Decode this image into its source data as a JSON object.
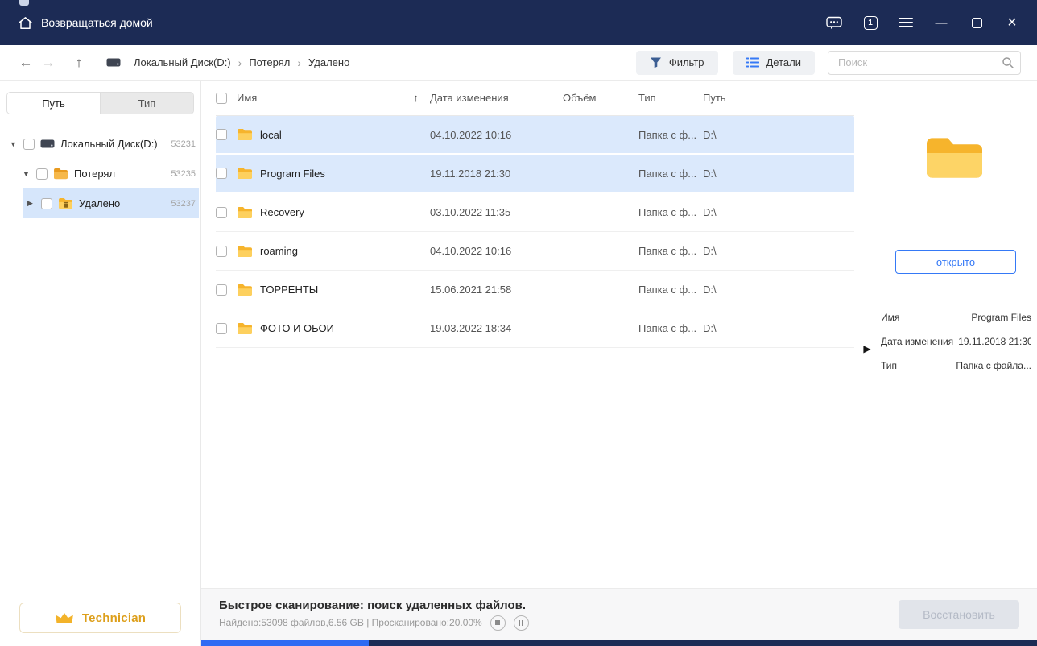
{
  "titlebar": {
    "home_label": "Возвращаться домой",
    "badge_count": "1"
  },
  "toolbar": {
    "breadcrumb": [
      "Локальный Диск(D:)",
      "Потерял",
      "Удалено"
    ],
    "filter_label": "Фильтр",
    "details_label": "Детали",
    "search_placeholder": "Поиск"
  },
  "sidebar": {
    "tabs": [
      {
        "label": "Путь",
        "active": true
      },
      {
        "label": "Тип",
        "active": false
      }
    ],
    "tree": [
      {
        "label": "Локальный Диск(D:)",
        "count": "53231",
        "icon": "drive-icon",
        "expanded": true
      },
      {
        "label": "Потерял",
        "count": "53235",
        "icon": "lost-folder-icon",
        "expanded": true
      },
      {
        "label": "Удалено",
        "count": "53237",
        "icon": "deleted-folder-icon",
        "expanded": false,
        "selected": true
      }
    ],
    "license_label": "Technician"
  },
  "filelist": {
    "columns": [
      "Имя",
      "Дата изменения",
      "Объём",
      "Тип",
      "Путь"
    ],
    "sort_column": "Имя",
    "rows": [
      {
        "name": "local",
        "date": "04.10.2022 10:16",
        "size": "",
        "type": "Папка с ф...",
        "path": "D:\\",
        "highlighted": true
      },
      {
        "name": "Program Files",
        "date": "19.11.2018 21:30",
        "size": "",
        "type": "Папка с ф...",
        "path": "D:\\",
        "highlighted": true
      },
      {
        "name": "Recovery",
        "date": "03.10.2022 11:35",
        "size": "",
        "type": "Папка с ф...",
        "path": "D:\\",
        "highlighted": false
      },
      {
        "name": "roaming",
        "date": "04.10.2022 10:16",
        "size": "",
        "type": "Папка с ф...",
        "path": "D:\\",
        "highlighted": false
      },
      {
        "name": "ТОРРЕНТЫ",
        "date": "15.06.2021 21:58",
        "size": "",
        "type": "Папка с ф...",
        "path": "D:\\",
        "highlighted": false
      },
      {
        "name": "ФОТО И ОБОИ",
        "date": "19.03.2022 18:34",
        "size": "",
        "type": "Папка с ф...",
        "path": "D:\\",
        "highlighted": false
      }
    ]
  },
  "preview": {
    "open_label": "открыто",
    "fields": [
      {
        "label": "Имя",
        "value": "Program Files"
      },
      {
        "label": "Дата изменения",
        "value": "19.11.2018 21:30"
      },
      {
        "label": "Тип",
        "value": "Папка с файла..."
      }
    ]
  },
  "statusbar": {
    "scan_title": "Быстрое сканирование: поиск удаленных файлов.",
    "scan_stats": "Найдено:53098 файлов,6.56 GB | Просканировано:20.00%",
    "progress_percent": 20,
    "recover_label": "Восстановить"
  },
  "icons": {
    "back": "←",
    "forward": "→",
    "up": "↑",
    "breadcrumb_separator": "›",
    "sort_asc": "↑",
    "expanded": "▼",
    "collapsed": "▶",
    "minimize": "—",
    "close": "×"
  },
  "colors": {
    "titlebar_bg": "#1c2b55",
    "accent_blue": "#3579f6",
    "row_selected_bg": "#dbe9fc",
    "sidebar_selected_bg": "#d6e6fb",
    "folder_yellow": "#f6b42c",
    "folder_yellow_light": "#fdd05e",
    "license_gold": "#dd9f1b",
    "progress_fill": "#2f6bf3",
    "progress_track": "#1c2b55",
    "recover_disabled_bg": "#e1e4ea"
  }
}
